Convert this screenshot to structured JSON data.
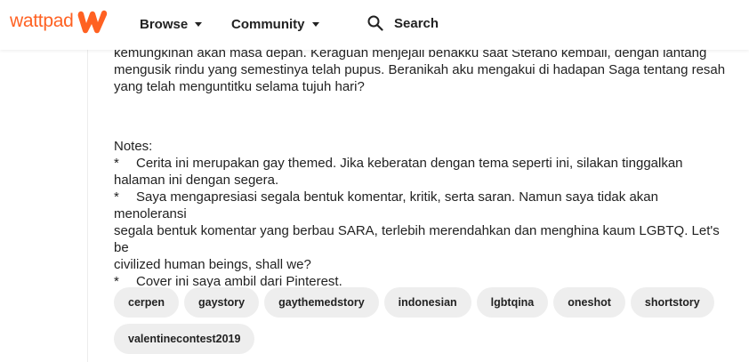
{
  "header": {
    "logo_text": "wattpad",
    "nav": [
      {
        "label": "Browse"
      },
      {
        "label": "Community"
      }
    ],
    "search_label": "Search"
  },
  "story": {
    "cut_line": "kemungkinan akan masa depan. Keraguan menjejali benakku saat Stefano kembali, dengan lantang",
    "lines": [
      "mengusik rindu yang semestinya telah pupus. Beranikah aku mengakui di hadapan Saga tentang resah",
      "yang telah menguntitku selama tujuh hari?"
    ],
    "notes_title": "Notes:",
    "bullet": "*",
    "notes": [
      {
        "l1": "Cerita ini merupakan gay themed. Jika keberatan dengan tema seperti ini, silakan tinggalkan",
        "l2": "halaman ini dengan segera."
      },
      {
        "l1": "Saya mengapresiasi segala bentuk komentar, kritik, serta saran. Namun saya tidak akan menoleransi",
        "l2": "segala bentuk komentar yang berbau SARA, terlebih merendahkan dan menghina kaum LGBTQ. Let's be",
        "l3": "civilized human beings, shall we?"
      },
      {
        "l1": "Cover ini saya ambil dari Pinterest."
      }
    ]
  },
  "tags": [
    "cerpen",
    "gaystory",
    "gaythemedstory",
    "indonesian",
    "lgbtqina",
    "oneshot",
    "shortstory",
    "valentinecontest2019"
  ],
  "colors": {
    "brand": "#ff6122",
    "tag_bg": "#eeeeee",
    "text": "#222222"
  }
}
